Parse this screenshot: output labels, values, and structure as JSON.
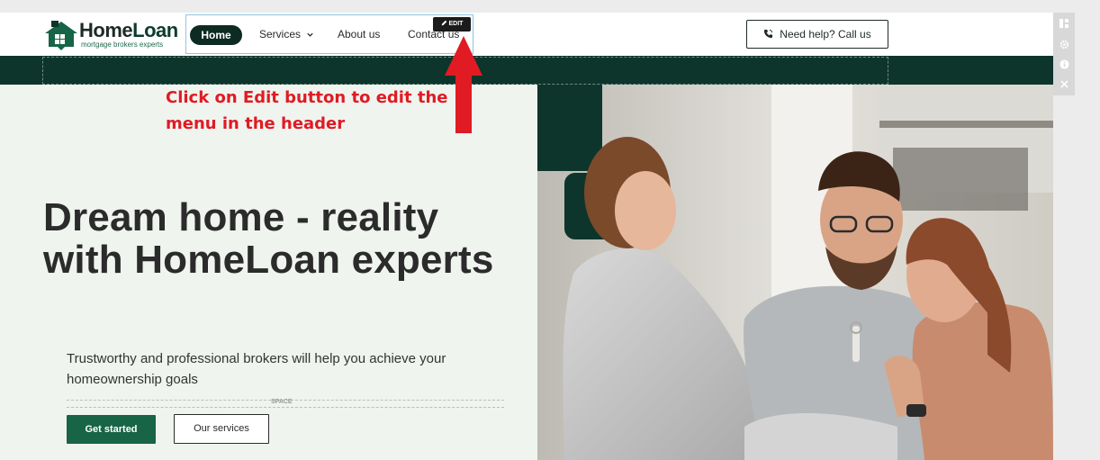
{
  "logo": {
    "name_part1": "Home",
    "name_part2": "Loan",
    "tagline": "mortgage brokers experts"
  },
  "nav": {
    "items": [
      {
        "label": "Home",
        "active": true
      },
      {
        "label": "Services",
        "has_dropdown": true
      },
      {
        "label": "About us"
      },
      {
        "label": "Contact us"
      }
    ],
    "edit_label": "EDIT"
  },
  "header": {
    "call_label": "Need help? Call us"
  },
  "annotation": {
    "text": "Click on Edit button to edit the menu in the header",
    "color": "#e01b24"
  },
  "hero": {
    "title": "Dream home - reality with HomeLoan experts",
    "subtitle": "Trustworthy and professional brokers will help you achieve your homeownership goals",
    "space_label": "SPACE",
    "primary_button": "Get started",
    "secondary_button": "Our services"
  },
  "toolbar": {
    "tools": [
      "layout-icon",
      "settings-icon",
      "info-icon",
      "close-icon"
    ]
  },
  "colors": {
    "brand_dark": "#0e352b",
    "brand_green": "#176447",
    "hero_bg": "#eff4ef",
    "annotation_red": "#e01b24"
  }
}
